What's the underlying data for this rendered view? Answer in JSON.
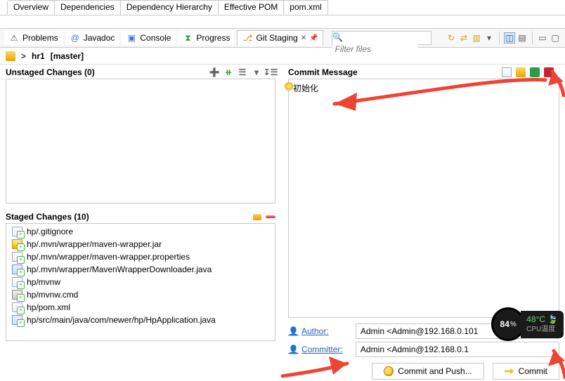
{
  "top_tabs": [
    "Overview",
    "Dependencies",
    "Dependency Hierarchy",
    "Effective POM",
    "pom.xml"
  ],
  "views": {
    "problems": "Problems",
    "javadoc": "Javadoc",
    "console": "Console",
    "progress": "Progress",
    "git_staging": "Git Staging"
  },
  "filter": {
    "placeholder": "Filter files"
  },
  "repo": {
    "prefix": ">",
    "name": "hr1",
    "branch": "[master]"
  },
  "unstaged": {
    "title": "Unstaged Changes",
    "count": "(0)"
  },
  "staged": {
    "title": "Staged Changes",
    "count": "(10)",
    "files": [
      "hp/.gitignore",
      "hp/.mvn/wrapper/maven-wrapper.jar",
      "hp/.mvn/wrapper/maven-wrapper.properties",
      "hp/.mvn/wrapper/MavenWrapperDownloader.java",
      "hp/mvnw",
      "hp/mvnw.cmd",
      "hp/pom.xml",
      "hp/src/main/java/com/newer/hp/HpApplication.java"
    ]
  },
  "commit": {
    "title": "Commit Message",
    "message": "初始化",
    "author_label": "Author:",
    "committer_label": "Committer:",
    "author": "Admin <Admin@192.168.0.101",
    "committer": "Admin <Admin@192.168.0.1"
  },
  "buttons": {
    "commit_push": "Commit and Push...",
    "commit": "Commit"
  },
  "cpu": {
    "pct": "84",
    "pct_sym": "%",
    "temp": "48°C",
    "temp_label": "CPU温度"
  },
  "icon_kinds": [
    "txt",
    "jar",
    "txt",
    "java",
    "txt",
    "cmd",
    "txt",
    "java"
  ]
}
